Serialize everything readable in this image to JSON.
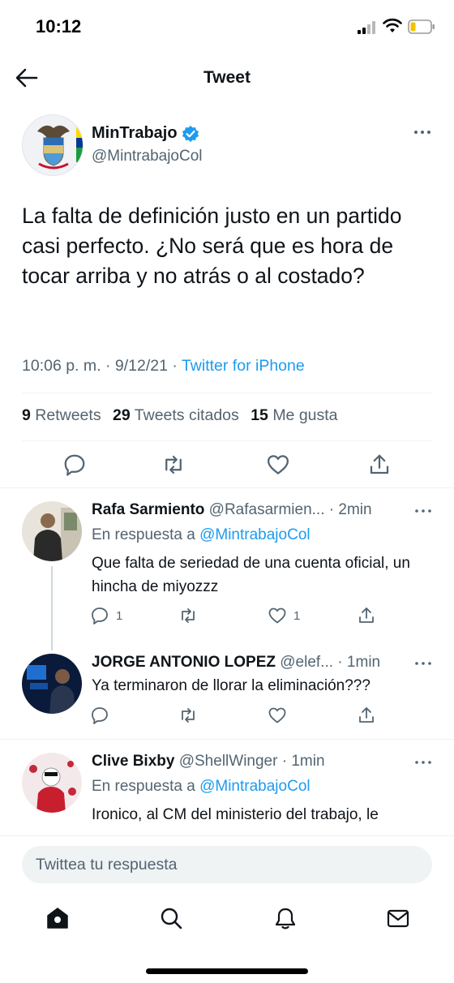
{
  "status_bar": {
    "time": "10:12"
  },
  "header": {
    "title": "Tweet",
    "back_icon": "arrow-left-icon"
  },
  "tweet": {
    "author_name": "MinTrabajo",
    "author_handle": "@MintrabajoCol",
    "text": "La falta de definición justo en un partido casi perfecto. ¿No será que es hora de tocar arriba y no atrás o al costado?",
    "time": "10:06 p. m.",
    "date": "9/12/21",
    "separator": "·",
    "source": "Twitter for iPhone",
    "stats": {
      "retweets_count": "9",
      "retweets_label": "Retweets",
      "quotes_count": "29",
      "quotes_label": "Tweets citados",
      "likes_count": "15",
      "likes_label": "Me gusta"
    }
  },
  "replies": [
    {
      "name": "Rafa Sarmiento",
      "handle": "@Rafasarmien...",
      "age": "· 2min",
      "reply_to_prefix": "En respuesta a",
      "reply_to_handle": "@MintrabajoCol",
      "text": "Que falta de seriedad de una cuenta oficial, un hincha de miyozzz",
      "reply_count": "1",
      "retweet_count": "",
      "like_count": "1"
    },
    {
      "name": "JORGE ANTONIO LOPEZ",
      "handle": "@elef...",
      "age": "· 1min",
      "text": "Ya terminaron de  llorar la eliminación???",
      "reply_count": "",
      "retweet_count": "",
      "like_count": ""
    },
    {
      "name": "Clive Bixby",
      "handle": "@ShellWinger",
      "age": "· 1min",
      "reply_to_prefix": "En respuesta a",
      "reply_to_handle": "@MintrabajoCol",
      "text": "Ironico, al CM del ministerio del trabajo, le"
    }
  ],
  "composer": {
    "placeholder": "Twittea tu respuesta"
  },
  "tab_bar": [
    "home-icon",
    "search-icon",
    "bell-icon",
    "mail-icon"
  ],
  "colors": {
    "accent": "#1d9bf0",
    "text": "#0f1419",
    "secondary": "#536471",
    "divider": "#eff3f4"
  }
}
